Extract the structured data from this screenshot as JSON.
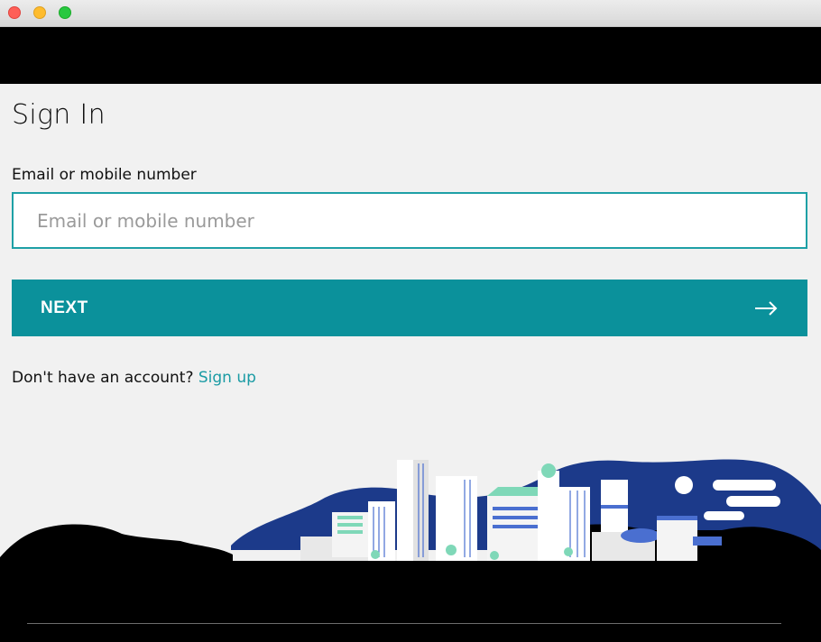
{
  "window": {
    "controls": [
      "close",
      "minimize",
      "maximize"
    ]
  },
  "signin": {
    "title": "Sign In",
    "field_label": "Email or mobile number",
    "input_placeholder": "Email or mobile number",
    "input_value": "",
    "next_label": "NEXT",
    "no_account_text": "Don't have an account?",
    "signup_link": "Sign up"
  },
  "colors": {
    "accent": "#0b919b",
    "link": "#1a9ba4",
    "illustration_navy": "#1c3a8a",
    "illustration_green": "#7fd8b8"
  },
  "icons": {
    "next": "arrow-right-icon",
    "illustration": "city-skyline-illustration"
  }
}
